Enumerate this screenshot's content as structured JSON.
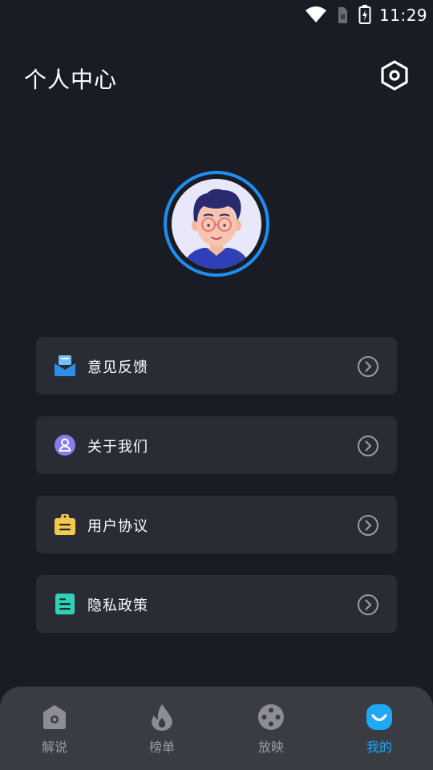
{
  "status_bar": {
    "time": "11:29"
  },
  "header": {
    "title": "个人中心"
  },
  "menu": {
    "items": [
      {
        "label": "意见反馈",
        "icon": "feedback-mail-icon",
        "color": "#3aa8f2"
      },
      {
        "label": "关于我们",
        "icon": "user-circle-icon",
        "color": "#8a7cf0"
      },
      {
        "label": "用户协议",
        "icon": "clipboard-icon",
        "color": "#f2c94c"
      },
      {
        "label": "隐私政策",
        "icon": "document-list-icon",
        "color": "#2ed3b7"
      }
    ]
  },
  "bottom_nav": {
    "items": [
      {
        "label": "解说",
        "icon": "camera-home-icon",
        "active": false
      },
      {
        "label": "榜单",
        "icon": "flame-icon",
        "active": false
      },
      {
        "label": "放映",
        "icon": "film-reel-icon",
        "active": false
      },
      {
        "label": "我的",
        "icon": "smile-face-icon",
        "active": true
      }
    ]
  },
  "colors": {
    "background": "#191c25",
    "card": "#2a2c35",
    "nav_bg": "#3a3c44",
    "accent": "#1fa9f4",
    "avatar_ring": "#1d8ff2",
    "inactive": "#9a9ba1"
  }
}
